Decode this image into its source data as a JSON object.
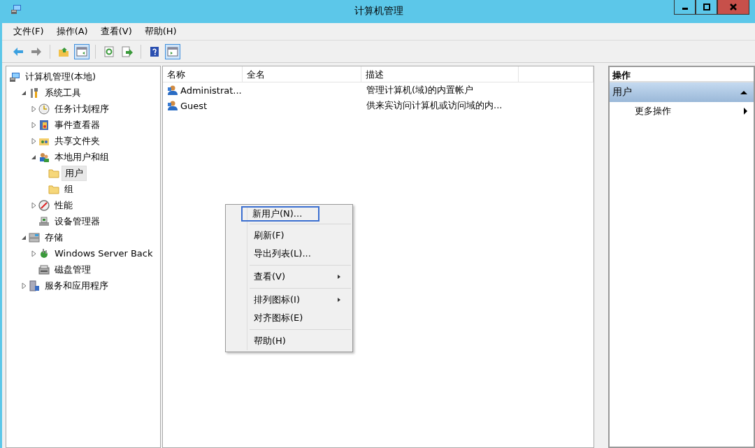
{
  "window": {
    "title": "计算机管理"
  },
  "menu": [
    {
      "label": "文件(F)"
    },
    {
      "label": "操作(A)"
    },
    {
      "label": "查看(V)"
    },
    {
      "label": "帮助(H)"
    }
  ],
  "toolbar": [
    {
      "kind": "back",
      "pressed": false
    },
    {
      "kind": "forward",
      "pressed": false
    },
    {
      "kind": "sep"
    },
    {
      "kind": "up",
      "pressed": false
    },
    {
      "kind": "tree",
      "pressed": true
    },
    {
      "kind": "sep"
    },
    {
      "kind": "refresh",
      "pressed": false
    },
    {
      "kind": "export",
      "pressed": false
    },
    {
      "kind": "sep"
    },
    {
      "kind": "help",
      "pressed": false
    },
    {
      "kind": "pane",
      "pressed": true
    }
  ],
  "tree": [
    {
      "label": "计算机管理(本地)",
      "kind": "computer",
      "selected": false,
      "children": [
        {
          "label": "系统工具",
          "kind": "tools",
          "expanded": true,
          "selected": false,
          "children": [
            {
              "label": "任务计划程序",
              "kind": "clock",
              "expanded": false,
              "selected": false
            },
            {
              "label": "事件查看器",
              "kind": "event",
              "expanded": false,
              "selected": false
            },
            {
              "label": "共享文件夹",
              "kind": "share",
              "expanded": false,
              "selected": false
            },
            {
              "label": "本地用户和组",
              "kind": "users",
              "expanded": true,
              "selected": false,
              "children": [
                {
                  "label": "用户",
                  "kind": "folder",
                  "selected": true
                },
                {
                  "label": "组",
                  "kind": "folder",
                  "selected": false
                }
              ]
            },
            {
              "label": "性能",
              "kind": "perf",
              "expanded": false,
              "selected": false
            },
            {
              "label": "设备管理器",
              "kind": "device",
              "selected": false
            }
          ]
        },
        {
          "label": "存储",
          "kind": "storage",
          "expanded": true,
          "selected": false,
          "children": [
            {
              "label": "Windows Server Back",
              "kind": "backup",
              "expanded": false,
              "selected": false
            },
            {
              "label": "磁盘管理",
              "kind": "disk",
              "selected": false
            }
          ]
        },
        {
          "label": "服务和应用程序",
          "kind": "services",
          "expanded": false,
          "selected": false
        }
      ]
    }
  ],
  "list": {
    "columns": [
      "名称",
      "全名",
      "描述"
    ],
    "rows": [
      {
        "name": "Administrat...",
        "description": "管理计算机(域)的内置帐户"
      },
      {
        "name": "Guest",
        "description": "供来宾访问计算机或访问域的内..."
      }
    ]
  },
  "actions": {
    "header": "操作",
    "section": "用户",
    "expanded": true,
    "items": [
      {
        "label": "更多操作",
        "submenu": true
      }
    ]
  },
  "context_menu": {
    "groups": [
      [
        {
          "label": "新用户(N)...",
          "selected": true,
          "submenu": false
        }
      ],
      [
        {
          "label": "刷新(F)",
          "selected": false,
          "submenu": false
        },
        {
          "label": "导出列表(L)...",
          "selected": false,
          "submenu": false
        }
      ],
      [
        {
          "label": "查看(V)",
          "selected": false,
          "submenu": true
        }
      ],
      [
        {
          "label": "排列图标(I)",
          "selected": false,
          "submenu": true
        },
        {
          "label": "对齐图标(E)",
          "selected": false,
          "submenu": false
        }
      ],
      [
        {
          "label": "帮助(H)",
          "selected": false,
          "submenu": false
        }
      ]
    ]
  }
}
